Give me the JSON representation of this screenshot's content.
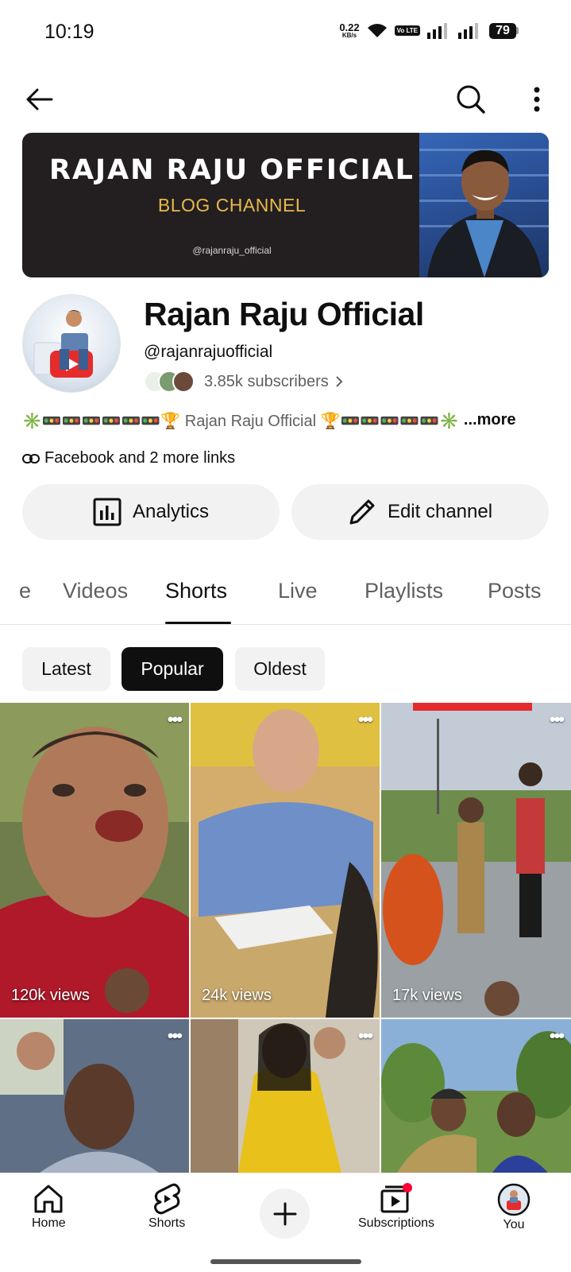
{
  "status_bar": {
    "time": "10:19",
    "net_speed_value": "0.22",
    "net_speed_unit": "KB/s",
    "volte_label": "Vo LTE",
    "battery": "79"
  },
  "top_bar": {
    "back_icon": "arrow-left-icon",
    "search_icon": "search-icon",
    "menu_icon": "more-vert-icon"
  },
  "banner": {
    "title": "RAJAN RAJU OFFICIAL",
    "subtitle": "BLOG CHANNEL",
    "handle": "@rajanraju_official"
  },
  "channel": {
    "name": "Rajan Raju Official",
    "handle": "@rajanrajuofficial",
    "subscribers": "3.85k subscribers",
    "description": "✳️🚥🚥🚥🚥🚥🚥🏆 Rajan Raju Official 🏆🚥🚥🚥🚥🚥✳️",
    "more_label": "...more",
    "links_label": "Facebook and 2 more links"
  },
  "actions": {
    "analytics_label": "Analytics",
    "edit_label": "Edit channel"
  },
  "tabs": [
    {
      "label": "e"
    },
    {
      "label": "Videos"
    },
    {
      "label": "Shorts"
    },
    {
      "label": "Live"
    },
    {
      "label": "Playlists"
    },
    {
      "label": "Posts"
    }
  ],
  "active_tab": "Shorts",
  "chips": [
    {
      "label": "Latest"
    },
    {
      "label": "Popular"
    },
    {
      "label": "Oldest"
    }
  ],
  "active_chip": "Popular",
  "shorts": [
    {
      "views": "120k views"
    },
    {
      "views": "24k views"
    },
    {
      "views": "17k views"
    },
    {
      "views": ""
    },
    {
      "views": ""
    },
    {
      "views": ""
    }
  ],
  "bottom_nav": {
    "home": "Home",
    "shorts": "Shorts",
    "subscriptions": "Subscriptions",
    "you": "You"
  },
  "colors": {
    "accent_red": "#ff0033",
    "chip_active": "#0f0f0f",
    "banner_bg": "#231f20",
    "banner_subtitle": "#e8b94a"
  }
}
